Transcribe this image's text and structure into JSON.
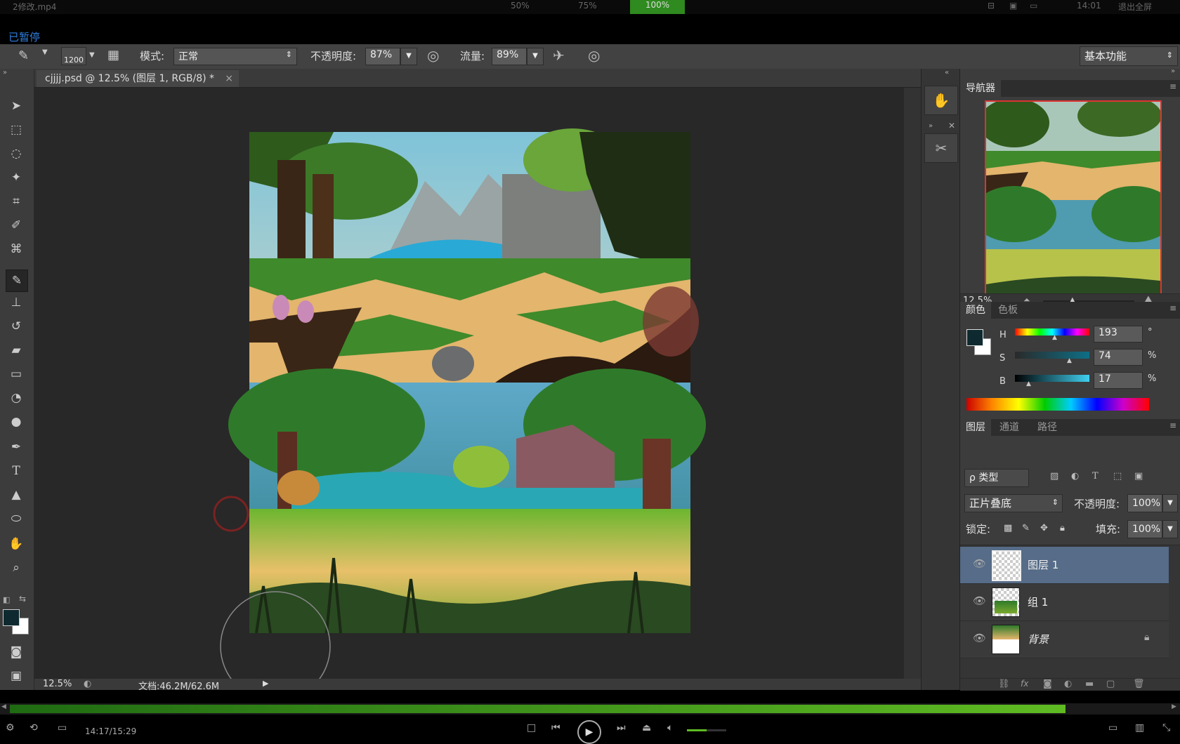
{
  "player": {
    "filename": "2修改.mp4",
    "zoom_options": [
      "50%",
      "75%",
      "100%"
    ],
    "time_top": "14:01",
    "exit_fullscreen": "退出全屏",
    "paused_label": "已暂停",
    "time_elapsed": "14:17/15:29",
    "progress_fraction": 0.91
  },
  "options": {
    "brush_size": "1200",
    "mode_label": "模式:",
    "mode_value": "正常",
    "opacity_label": "不透明度:",
    "opacity_value": "87%",
    "flow_label": "流量:",
    "flow_value": "89%",
    "workspace": "基本功能"
  },
  "document": {
    "tab_title": "cjjjj.psd @ 12.5% (图层 1, RGB/8) *",
    "close_glyph": "×",
    "zoom": "12.5%",
    "doc_size": "文档:46.2M/62.6M"
  },
  "navigator": {
    "tab": "导航器",
    "zoom": "12.5%"
  },
  "color": {
    "tabs": [
      "颜色",
      "色板"
    ],
    "h_label": "H",
    "h_value": "193",
    "h_unit": "°",
    "s_label": "S",
    "s_value": "74",
    "s_unit": "%",
    "b_label": "B",
    "b_value": "17",
    "b_unit": "%",
    "fg": "#0e2a30",
    "bg": "#ffffff"
  },
  "layers": {
    "tabs": [
      "图层",
      "通道",
      "路径"
    ],
    "filter": "ρ 类型",
    "blend_mode": "正片叠底",
    "opacity_label": "不透明度:",
    "opacity_value": "100%",
    "lock_label": "锁定:",
    "fill_label": "填充:",
    "fill_value": "100%",
    "items": [
      {
        "name": "图层 1",
        "selected": true
      },
      {
        "name": "组 1",
        "selected": false
      },
      {
        "name": "背景",
        "selected": false,
        "locked": true
      }
    ]
  },
  "icons": {
    "eye": "eye-icon",
    "lock": "lock-icon",
    "link": "link-icon",
    "fx": "fx-icon"
  }
}
